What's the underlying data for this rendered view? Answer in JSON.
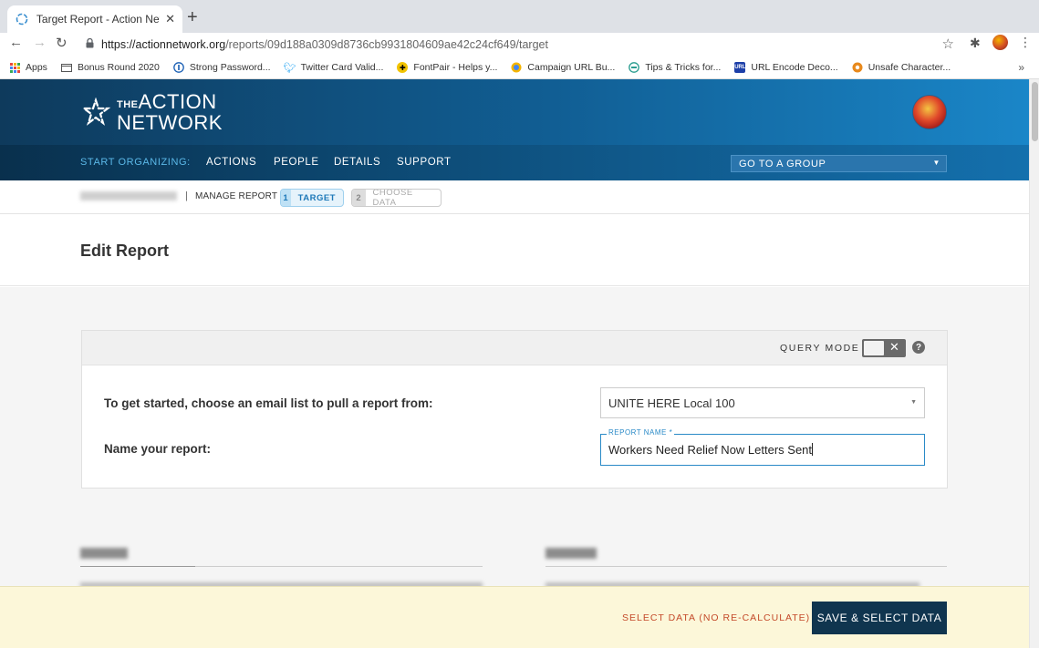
{
  "browser": {
    "tab_title": "Target Report - Action Network",
    "tab_close": "✕",
    "new_tab": "+",
    "url_domain": "https://actionnetwork.org",
    "url_path": "/reports/09d188a0309d8736cb9931804609ae42c24cf649/target",
    "bookmarks": [
      {
        "label": "Apps",
        "icon": "apps-grid-icon"
      },
      {
        "label": "Bonus Round 2020",
        "icon": "folder-icon"
      },
      {
        "label": "Strong Password...",
        "icon": "password-icon"
      },
      {
        "label": "Twitter Card Valid...",
        "icon": "twitter-icon"
      },
      {
        "label": "FontPair - Helps y...",
        "icon": "fontpair-icon"
      },
      {
        "label": "Campaign URL Bu...",
        "icon": "campaign-icon"
      },
      {
        "label": "Tips & Tricks for...",
        "icon": "tips-icon"
      },
      {
        "label": "URL Encode Deco...",
        "icon": "url-encode-icon"
      },
      {
        "label": "Unsafe Character...",
        "icon": "unsafe-icon"
      }
    ],
    "bookmarks_more": "»"
  },
  "site": {
    "logo_the": "THE",
    "logo_line1": "ACTION",
    "logo_line2": "NETWORK",
    "nav_start": "START ORGANIZING:",
    "nav_items": [
      "ACTIONS",
      "PEOPLE",
      "DETAILS",
      "SUPPORT"
    ],
    "group_select": "GO TO A GROUP"
  },
  "breadcrumb": {
    "separator": "|",
    "manage": "MANAGE REPORT",
    "steps": [
      {
        "num": "1",
        "label": "TARGET"
      },
      {
        "num": "2",
        "label": "CHOOSE DATA"
      }
    ]
  },
  "page": {
    "title": "Edit Report"
  },
  "card": {
    "query_mode_label": "QUERY MODE",
    "query_mode_off": "✕",
    "help": "?",
    "list_prompt": "To get started, choose an email list to pull a report from:",
    "list_value": "UNITE HERE Local 100",
    "name_prompt": "Name your report:",
    "name_legend": "REPORT NAME *",
    "name_value": "Workers Need Relief Now Letters Sent"
  },
  "actions": {
    "select_data": "SELECT DATA (NO RE-CALCULATE)",
    "save": "SAVE & SELECT DATA"
  },
  "colors": {
    "header_dark": "#0e3a5c",
    "header_light": "#1a86c8",
    "accent_blue": "#2a8ac7",
    "save_button": "#10354f",
    "select_link": "#c44a2a",
    "action_bar": "#fcf7d9"
  }
}
